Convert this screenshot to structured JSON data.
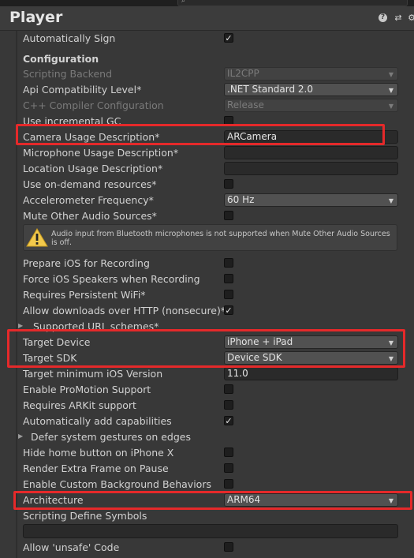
{
  "header": {
    "title": "Player"
  },
  "rows": [
    {
      "label": "Automatically Sign",
      "control": "checkbox",
      "checked": true
    },
    {
      "label": "Configuration",
      "section": true
    },
    {
      "label": "Scripting Backend",
      "control": "dropdown",
      "value": "IL2CPP",
      "disabled": true
    },
    {
      "label": "Api Compatibility Level*",
      "control": "dropdown",
      "value": ".NET Standard 2.0"
    },
    {
      "label": "C++ Compiler Configuration",
      "control": "dropdown",
      "value": "Release",
      "disabled": true
    },
    {
      "label": "Use incremental GC",
      "control": "checkbox",
      "checked": false
    },
    {
      "label": "Camera Usage Description*",
      "control": "text",
      "value": "ARCamera"
    },
    {
      "label": "Microphone Usage Description*",
      "control": "text",
      "value": ""
    },
    {
      "label": "Location Usage Description*",
      "control": "text",
      "value": ""
    },
    {
      "label": "Use on-demand resources*",
      "control": "checkbox",
      "checked": false
    },
    {
      "label": "Accelerometer Frequency*",
      "control": "dropdown",
      "value": "60 Hz"
    },
    {
      "label": "Mute Other Audio Sources*",
      "control": "checkbox",
      "checked": false
    },
    {
      "label": "Prepare iOS for Recording",
      "control": "checkbox",
      "checked": false
    },
    {
      "label": "Force iOS Speakers when Recording",
      "control": "checkbox",
      "checked": false
    },
    {
      "label": "Requires Persistent WiFi*",
      "control": "checkbox",
      "checked": false
    },
    {
      "label": "Allow downloads over HTTP (nonsecure)*",
      "control": "checkbox",
      "checked": true
    },
    {
      "label": "Supported URL schemes*",
      "control": "foldout"
    },
    {
      "label": "Target Device",
      "control": "dropdown",
      "value": "iPhone + iPad"
    },
    {
      "label": "Target SDK",
      "control": "dropdown",
      "value": "Device SDK"
    },
    {
      "label": "Target minimum iOS Version",
      "control": "text",
      "value": "11.0"
    },
    {
      "label": "Enable ProMotion Support",
      "control": "checkbox",
      "checked": false
    },
    {
      "label": "Requires ARKit support",
      "control": "checkbox",
      "checked": false
    },
    {
      "label": "Automatically add capabilities",
      "control": "checkbox",
      "checked": true
    },
    {
      "label": "Defer system gestures on edges",
      "control": "foldout"
    },
    {
      "label": "Hide home button on iPhone X",
      "control": "checkbox",
      "checked": false
    },
    {
      "label": "Render Extra Frame on Pause",
      "control": "checkbox",
      "checked": false
    },
    {
      "label": "Enable Custom Background Behaviors",
      "control": "checkbox",
      "checked": false
    },
    {
      "label": "Architecture",
      "control": "dropdown",
      "value": "ARM64"
    },
    {
      "label": "Scripting Define Symbols",
      "control": "none"
    },
    {
      "label": "Allow 'unsafe' Code",
      "control": "checkbox",
      "checked": false
    }
  ],
  "warning": {
    "text": "Audio input from Bluetooth microphones is not supported when Mute Other Audio Sources is off."
  },
  "highlight_color": "#e5292a",
  "icons": {
    "help": "help-icon",
    "preset": "preset-icon",
    "settings": "gear-icon",
    "warning": "warning-icon",
    "check": "checkmark-icon",
    "dropdown": "chevron-down-icon",
    "foldout": "triangle-right-icon"
  }
}
